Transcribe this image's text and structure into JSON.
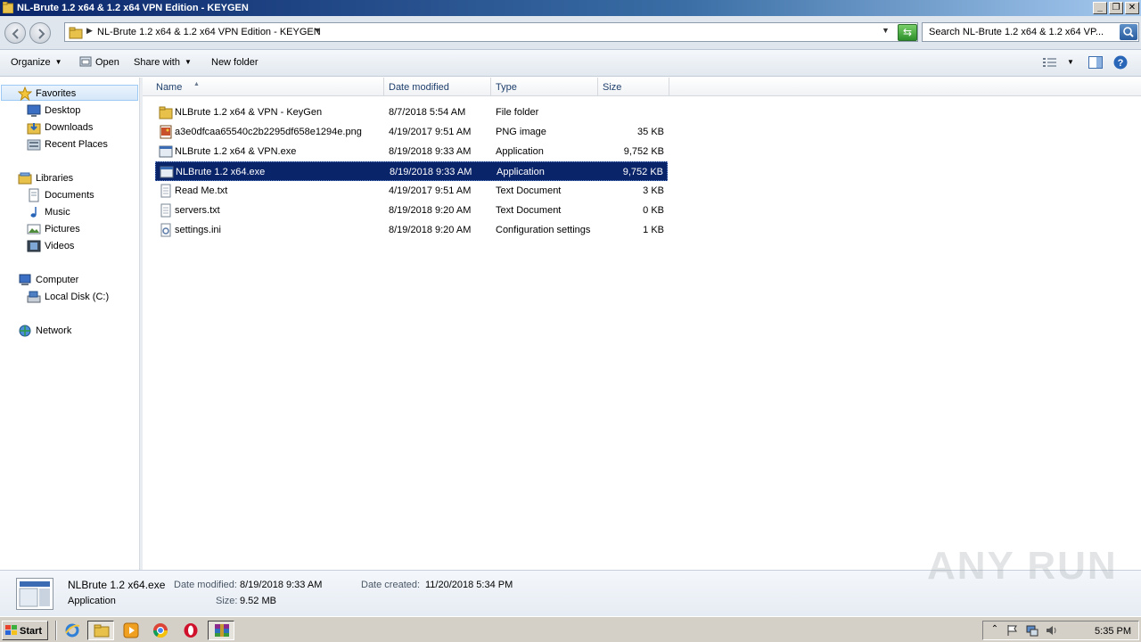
{
  "window": {
    "title": "NL-Brute 1.2 x64 & 1.2 x64 VPN Edition - KEYGEN",
    "buttons": {
      "minimize": "_",
      "maximize": "❐",
      "close": "✕"
    }
  },
  "address": {
    "path": "NL-Brute 1.2 x64 & 1.2 x64 VPN Edition - KEYGEN",
    "search_placeholder": "Search NL-Brute 1.2 x64 & 1.2 x64 VP..."
  },
  "toolbar": {
    "organize": "Organize",
    "open": "Open",
    "share_with": "Share with",
    "new_folder": "New folder"
  },
  "nav": {
    "favorites": {
      "label": "Favorites",
      "items": [
        "Desktop",
        "Downloads",
        "Recent Places"
      ]
    },
    "libraries": {
      "label": "Libraries",
      "items": [
        "Documents",
        "Music",
        "Pictures",
        "Videos"
      ]
    },
    "computer": {
      "label": "Computer",
      "items": [
        "Local Disk (C:)"
      ]
    },
    "network": {
      "label": "Network"
    }
  },
  "columns": {
    "name": "Name",
    "date": "Date modified",
    "type": "Type",
    "size": "Size"
  },
  "files": [
    {
      "name": "NLBrute 1.2 x64 & VPN - KeyGen",
      "date": "8/7/2018 5:54 AM",
      "type": "File folder",
      "size": "",
      "icon": "folder-icon"
    },
    {
      "name": "a3e0dfcaa65540c2b2295df658e1294e.png",
      "date": "4/19/2017 9:51 AM",
      "type": "PNG image",
      "size": "35 KB",
      "icon": "image-file-icon"
    },
    {
      "name": "NLBrute 1.2 x64 & VPN.exe",
      "date": "8/19/2018 9:33 AM",
      "type": "Application",
      "size": "9,752 KB",
      "icon": "application-icon"
    },
    {
      "name": "NLBrute 1.2 x64.exe",
      "date": "8/19/2018 9:33 AM",
      "type": "Application",
      "size": "9,752 KB",
      "icon": "application-icon",
      "selected": true
    },
    {
      "name": "Read Me.txt",
      "date": "4/19/2017 9:51 AM",
      "type": "Text Document",
      "size": "3 KB",
      "icon": "text-file-icon"
    },
    {
      "name": "servers.txt",
      "date": "8/19/2018 9:20 AM",
      "type": "Text Document",
      "size": "0 KB",
      "icon": "text-file-icon"
    },
    {
      "name": "settings.ini",
      "date": "8/19/2018 9:20 AM",
      "type": "Configuration settings",
      "size": "1 KB",
      "icon": "config-file-icon"
    }
  ],
  "details": {
    "name": "NLBrute 1.2 x64.exe",
    "type": "Application",
    "date_modified_label": "Date modified:",
    "date_modified": "8/19/2018 9:33 AM",
    "size_label": "Size:",
    "size": "9.52 MB",
    "date_created_label": "Date created:",
    "date_created": "11/20/2018 5:34 PM"
  },
  "watermark": "ANY RUN",
  "taskbar": {
    "start": "Start",
    "clock": "5:35 PM"
  }
}
